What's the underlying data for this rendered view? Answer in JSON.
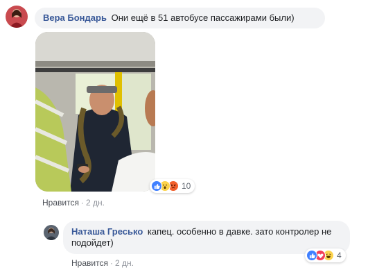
{
  "comment1": {
    "author": "Вера Бондарь",
    "text": "Они ещё в 51 автобусе пассажирами были)",
    "reactions": {
      "icons": [
        "like-icon",
        "wow-icon",
        "angry-icon"
      ],
      "count": "10"
    },
    "actions": {
      "like": "Нравится",
      "separator": "·",
      "time": "2 дн."
    }
  },
  "reply1": {
    "author": "Наташа Гресько",
    "text": "капец. особенно в давке. зато контролер не подойдет)",
    "reactions": {
      "icons": [
        "like-icon",
        "love-icon",
        "haha-icon"
      ],
      "count": "4"
    },
    "actions": {
      "like": "Нравится",
      "separator": "·",
      "time": "2 дн."
    }
  },
  "colors": {
    "author": "#385898",
    "bubble": "#f2f3f5",
    "like": "#4080ff",
    "love": "#f33e58",
    "angry": "#f25f2b",
    "wow": "#fcd34d"
  }
}
